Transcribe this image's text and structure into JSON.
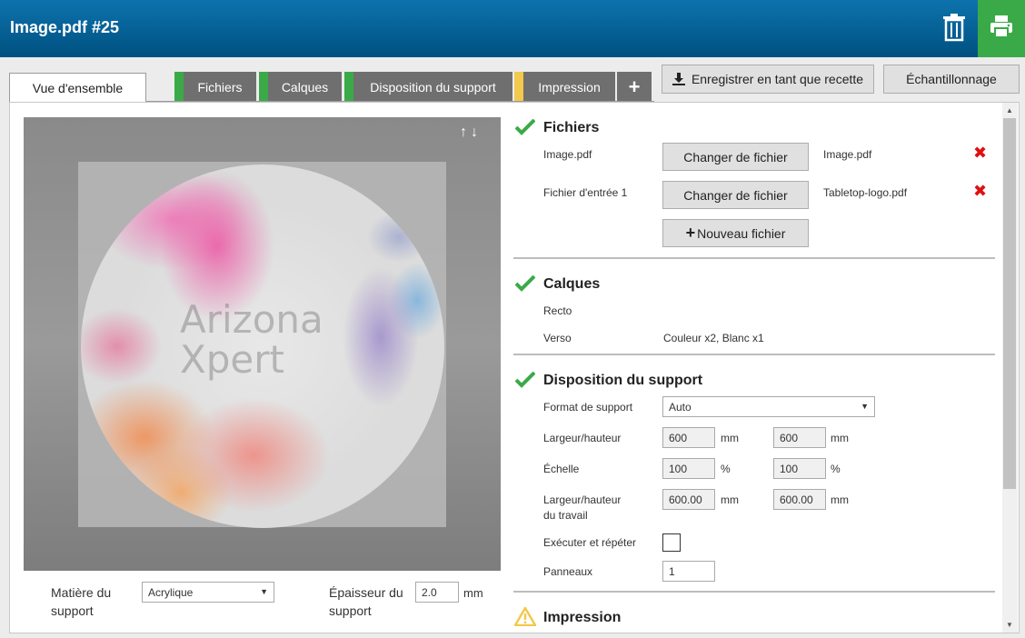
{
  "window": {
    "title": "Image.pdf #25"
  },
  "tabs": [
    {
      "label": "Vue d'ensemble",
      "active": true
    },
    {
      "label": "Fichiers",
      "status_color": "#3aaa48"
    },
    {
      "label": "Calques",
      "status_color": "#3aaa48"
    },
    {
      "label": "Disposition du support",
      "status_color": "#3aaa48"
    },
    {
      "label": "Impression",
      "status_color": "#f2c94c"
    },
    {
      "label": "+"
    }
  ],
  "toolbar": {
    "save_recipe": "Enregistrer en tant que recette",
    "sampling": "Échantillonnage"
  },
  "preview": {
    "watermark_line1": "Arizona",
    "watermark_line2": "Xpert",
    "arrows": "↑↓"
  },
  "bottom": {
    "material_label_1": "Matière du",
    "material_label_2": "support",
    "material_value": "Acrylique",
    "thickness_label_1": "Épaisseur du",
    "thickness_label_2": "support",
    "thickness_value": "2.0",
    "thickness_unit": "mm"
  },
  "files": {
    "title": "Fichiers",
    "row1_label": "Image.pdf",
    "row1_button": "Changer de fichier",
    "row1_file": "Image.pdf",
    "row2_label": "Fichier d'entrée 1",
    "row2_button": "Changer de fichier",
    "row2_file": "Tabletop-logo.pdf",
    "new_file": "Nouveau fichier"
  },
  "layers": {
    "title": "Calques",
    "front_label": "Recto",
    "back_label": "Verso",
    "back_value": "Couleur x2, Blanc x1"
  },
  "layout": {
    "title": "Disposition du support",
    "format_label": "Format de support",
    "format_value": "Auto",
    "size_label": "Largeur/hauteur",
    "width": "600",
    "height": "600",
    "unit_mm": "mm",
    "scale_label": "Échelle",
    "scale_x": "100",
    "scale_y": "100",
    "unit_pct": "%",
    "job_size_label_1": "Largeur/hauteur",
    "job_size_label_2": "du travail",
    "job_width": "600.00",
    "job_height": "600.00",
    "step_repeat_label": "Exécuter et répéter",
    "panels_label": "Panneaux",
    "panels_value": "1"
  },
  "print": {
    "title": "Impression"
  },
  "colors": {
    "header": "#0d73ad",
    "print_button": "#3aaa48",
    "ok": "#3aaa48",
    "warn": "#f2c94c",
    "error": "#e01010"
  }
}
